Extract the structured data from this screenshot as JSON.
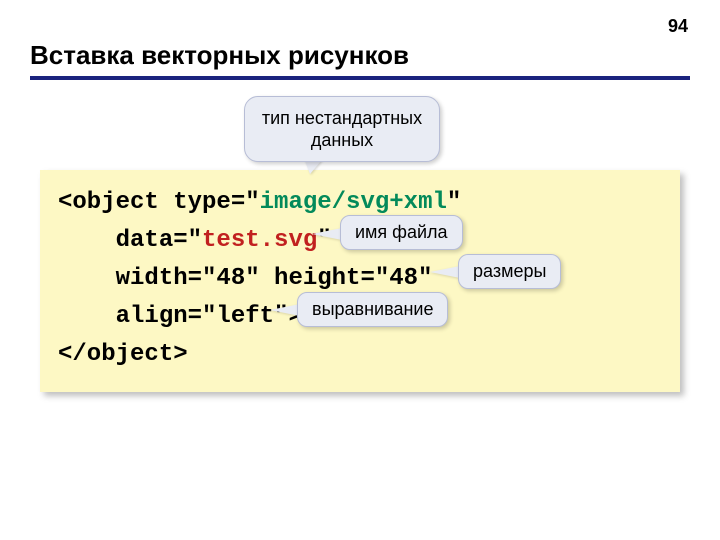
{
  "page_number": "94",
  "heading": "Вставка векторных рисунков",
  "code": {
    "l1a": "<object type=\"",
    "l1b": "image/svg+xml",
    "l1c": "\"",
    "l2a": "    data=\"",
    "l2b": "test.svg",
    "l2c": "\"",
    "l3": "    width=\"48\" height=\"48\"",
    "l4": "    align=\"left\">",
    "l5": "</object>"
  },
  "callouts": {
    "c1": "тип нестандартных данных",
    "c2": "имя файла",
    "c3": "размеры",
    "c4": "выравнивание"
  }
}
